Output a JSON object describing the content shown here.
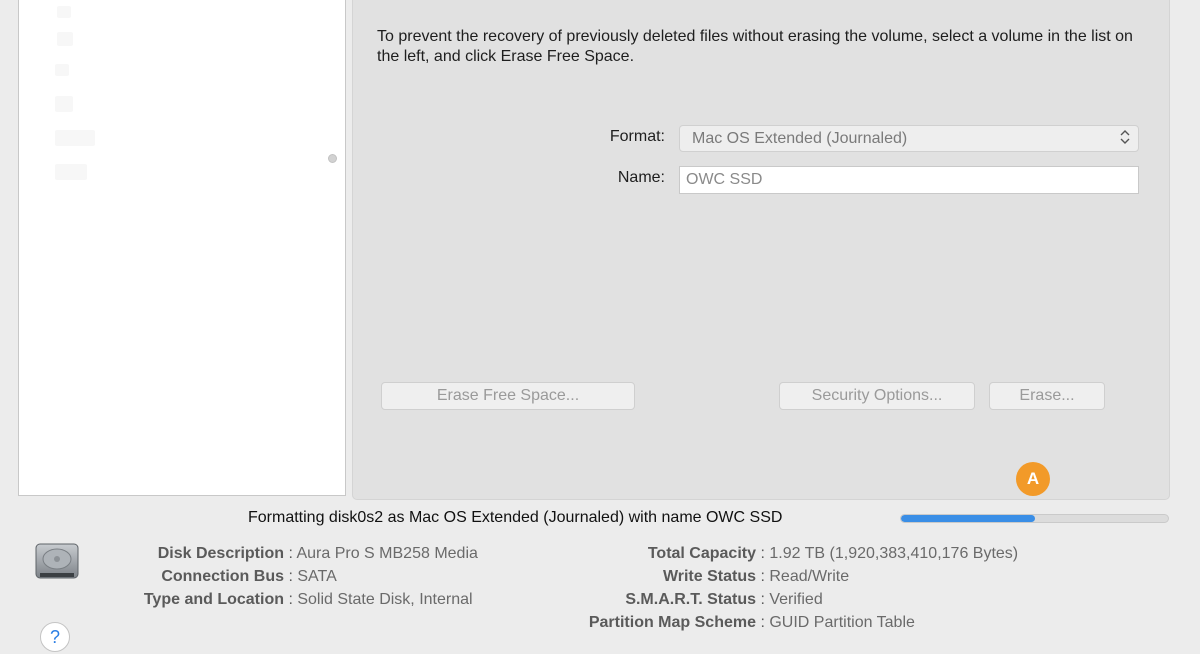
{
  "panel": {
    "instructions": "To prevent the recovery of previously deleted files without erasing the volume, select a volume in the list on the left, and click Erase Free Space.",
    "format_label": "Format:",
    "format_value": "Mac OS Extended (Journaled)",
    "name_label": "Name:",
    "name_value": "OWC SSD"
  },
  "buttons": {
    "erase_free_space": "Erase Free Space...",
    "security_options": "Security Options...",
    "erase": "Erase..."
  },
  "badge": {
    "label": "A",
    "color": "#f29a29"
  },
  "status": {
    "text": "Formatting disk0s2 as Mac OS Extended (Journaled) with name OWC SSD",
    "progress_fraction": 0.5,
    "progress_color": "#3a8ee6"
  },
  "info": {
    "left": [
      {
        "key": "Disk Description",
        "value": "Aura Pro S MB258 Media"
      },
      {
        "key": "Connection Bus",
        "value": "SATA"
      },
      {
        "key": "Type and Location",
        "value": "Solid State Disk, Internal"
      }
    ],
    "right": [
      {
        "key": "Total Capacity",
        "value": "1.92 TB (1,920,383,410,176 Bytes)"
      },
      {
        "key": "Write Status",
        "value": "Read/Write"
      },
      {
        "key": "S.M.A.R.T. Status",
        "value": "Verified"
      },
      {
        "key": "Partition Map Scheme",
        "value": "GUID Partition Table"
      }
    ],
    "separator": ":"
  },
  "help": {
    "label": "?"
  },
  "icons": {
    "disk": "hard-disk-icon",
    "help": "help-icon",
    "popup": "chevron-updown-icon"
  }
}
